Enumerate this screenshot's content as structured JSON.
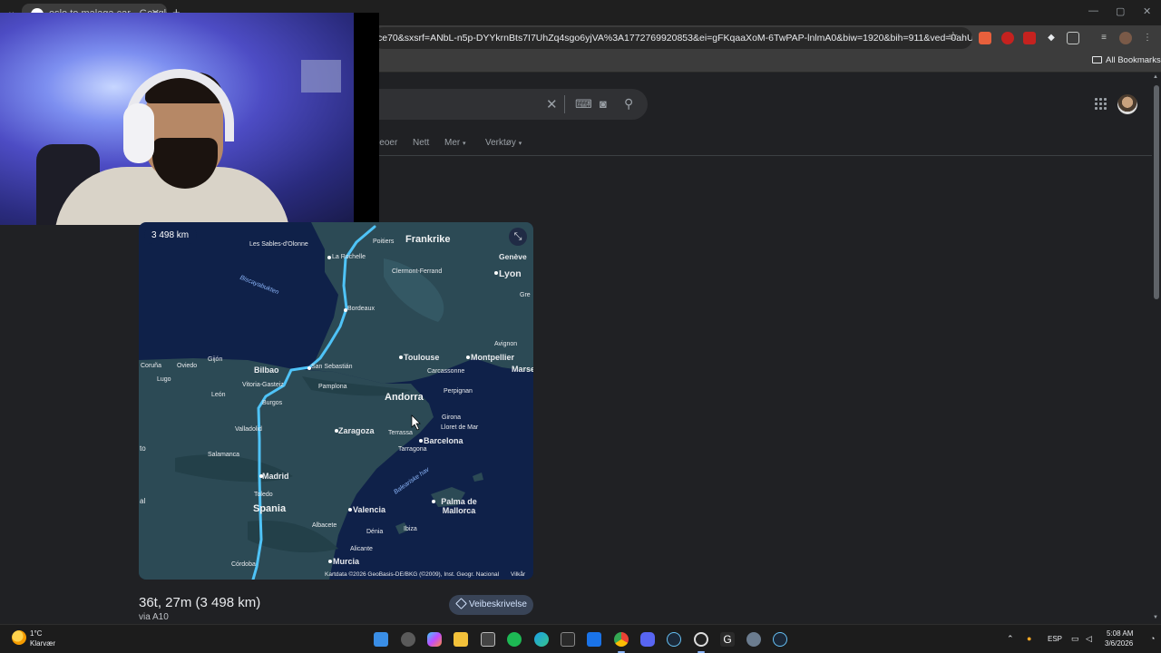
{
  "browser": {
    "tab_title": "oslo to malaga car - Google S",
    "url": "ce70&sxsrf=ANbL-n5p-DYYkrnBts7I7UhZq4sgo6yjVA%3A1772769920853&ei=gFKqaaXoM-6TwPAP-lnlmA0&biw=1920&bih=911&ved=0ahUKEwilqIr...",
    "all_bookmarks": "All Bookmarks",
    "window_controls": [
      "—",
      "▢",
      "✕"
    ]
  },
  "search": {
    "clear_icon": "close-icon",
    "keyboard_icon": "keyboard-icon",
    "lens_icon": "lens-icon",
    "search_icon": "search-icon"
  },
  "nav": {
    "items": [
      "Videoer",
      "Nett",
      "Mer",
      "Verktøy"
    ]
  },
  "map": {
    "distance_badge": "3 498 km",
    "countries": {
      "france": "Frankrike",
      "spain": "Spania",
      "andorra": "Andorra"
    },
    "seas": {
      "biscay": "Biscayabukten",
      "balearic": "Baleariske hav"
    },
    "cities_major": {
      "lyon": "Lyon",
      "geneve": "Genève",
      "toulouse": "Toulouse",
      "montpellier": "Montpellier",
      "marseille": "Marse",
      "bilbao": "Bilbao",
      "zaragoza": "Zaragoza",
      "barcelona": "Barcelona",
      "madrid": "Madrid",
      "valencia": "Valencia",
      "palma": "Palma de Mallorca",
      "murcia": "Murcia"
    },
    "cities_minor": {
      "sables": "Les Sables-d'Olonne",
      "poitiers": "Poitiers",
      "rochelle": "La Rochelle",
      "clermont": "Clermont-Ferrand",
      "bordeaux": "Bordeaux",
      "avignon": "Avignon",
      "carcassonne": "Carcassonne",
      "perpignan": "Perpignan",
      "girona": "Girona",
      "lloret": "Lloret de Mar",
      "terrassa": "Terrassa",
      "tarragona": "Tarragona",
      "sansebastian": "San Sebastián",
      "vitoria": "Vitoria-Gasteiz",
      "pamplona": "Pamplona",
      "burgos": "Burgos",
      "gijon": "Gijón",
      "oviedo": "Oviedo",
      "coruna": "Coruña",
      "lugo": "Lugo",
      "leon": "León",
      "valladolid": "Valladolid",
      "salamanca": "Salamanca",
      "toledo": "Toledo",
      "albacete": "Albacete",
      "denia": "Dénia",
      "ibiza": "Ibiza",
      "alicante": "Alicante",
      "cordoba": "Córdoba",
      "gre": "Gre",
      "to": "to",
      "al": "al"
    },
    "attribution": "Kartdata ©2026 GeoBasis-DE/BKG (©2009), Inst. Geogr. Nacional",
    "terms": "Vilkår",
    "expand_icon": "collapse-arrows-icon"
  },
  "route": {
    "time_distance": "36t, 27m (3 498 km)",
    "via": "via A10",
    "directions_label": "Veibeskrivelse"
  },
  "taskbar": {
    "temperature": "1°C",
    "weather": "Klarvær",
    "language": "ESP",
    "time": "5:08 AM",
    "date": "3/6/2026",
    "apps": [
      "windows-start-icon",
      "settings-icon",
      "copilot-icon",
      "file-explorer-icon",
      "store-icon",
      "spotify-icon",
      "edge-icon",
      "epic-games-icon",
      "mail-icon",
      "chrome-icon",
      "discord-icon",
      "steam-icon",
      "obs-icon",
      "logitech-icon",
      "gear-icon",
      "steam-icon-2"
    ]
  },
  "colors": {
    "route": "#4fc3f7",
    "map_water": "#0f2149",
    "map_land": "#2c4a55",
    "page_bg": "#202124"
  }
}
